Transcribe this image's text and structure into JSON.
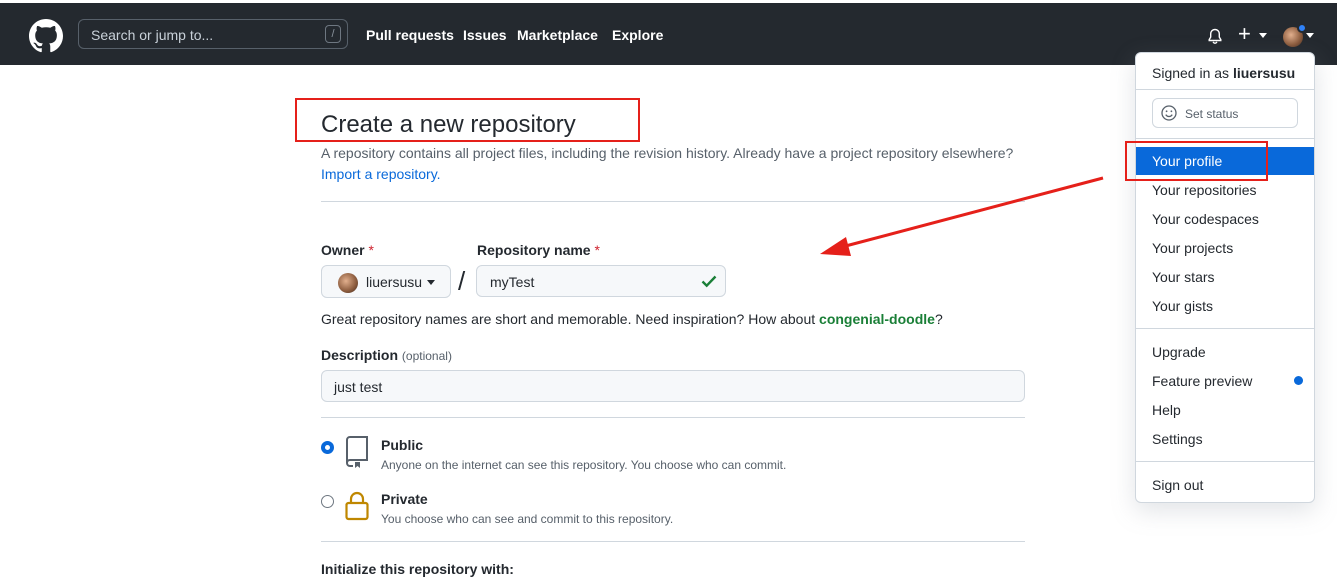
{
  "header": {
    "search_placeholder": "Search or jump to...",
    "search_shortcut": "/",
    "nav": [
      "Pull requests",
      "Issues",
      "Marketplace",
      "Explore"
    ],
    "plus_label": "+"
  },
  "page": {
    "title": "Create a new repository",
    "subtitle": "A repository contains all project files, including the revision history. Already have a project repository elsewhere?",
    "import_link": "Import a repository.",
    "owner_label": "Owner",
    "repo_label": "Repository name",
    "required_mark": "*",
    "owner_value": "liuersusu",
    "separator": "/",
    "repo_value": "myTest",
    "hint_prefix": "Great repository names are short and memorable. Need inspiration? How about ",
    "hint_suggestion": "congenial-doodle",
    "hint_suffix": "?",
    "description_label": "Description",
    "description_optional": "(optional)",
    "description_value": "just test",
    "visibility": [
      {
        "title": "Public",
        "desc": "Anyone on the internet can see this repository. You choose who can commit.",
        "selected": true
      },
      {
        "title": "Private",
        "desc": "You choose who can see and commit to this repository.",
        "selected": false
      }
    ],
    "init_label": "Initialize this repository with:"
  },
  "dropdown": {
    "signed_prefix": "Signed in as",
    "username": "liuersusu",
    "set_status": "Set status",
    "items_group1": [
      "Your profile",
      "Your repositories",
      "Your codespaces",
      "Your projects",
      "Your stars",
      "Your gists"
    ],
    "items_group2": [
      "Upgrade",
      "Feature preview",
      "Help",
      "Settings"
    ],
    "sign_out": "Sign out"
  },
  "colors": {
    "header_bg": "#24292f",
    "accent": "#0969da",
    "annotation": "#e5201a",
    "success": "#1a7f37"
  }
}
